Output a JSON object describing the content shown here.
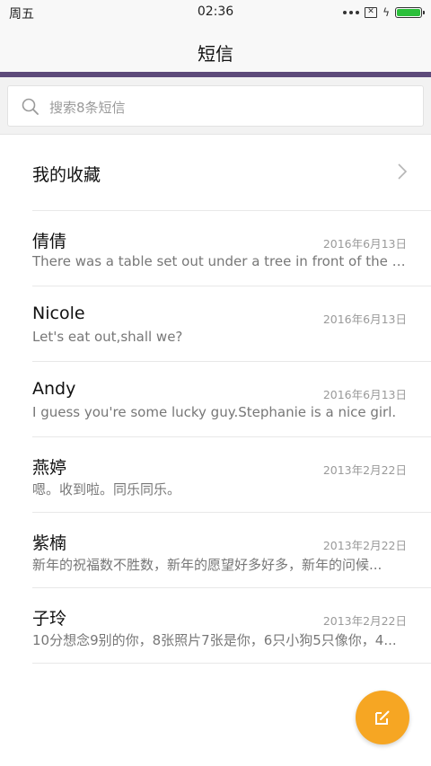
{
  "status": {
    "day": "周五",
    "time": "02:36",
    "battery_level": 1.0,
    "battery_color": "#2bbf3a"
  },
  "header": {
    "title": "短信",
    "accent_color": "#5d4a7a"
  },
  "search": {
    "placeholder": "搜索8条短信"
  },
  "favorites": {
    "label": "我的收藏"
  },
  "messages": [
    {
      "name": "倩倩",
      "date": "2016年6月13日",
      "preview": "There was a table set out under a tree in front of the ho..."
    },
    {
      "name": "Nicole",
      "date": "2016年6月13日",
      "preview": "Let's eat out,shall we?"
    },
    {
      "name": "Andy",
      "date": "2016年6月13日",
      "preview": "I guess you're some lucky guy.Stephanie is a nice girl."
    },
    {
      "name": "燕婷",
      "date": "2013年2月22日",
      "preview": "嗯。收到啦。同乐同乐。"
    },
    {
      "name": "紫楠",
      "date": "2013年2月22日",
      "preview": "新年的祝福数不胜数，新年的愿望好多好多，新年的问候..."
    },
    {
      "name": "子玲",
      "date": "2013年2月22日",
      "preview": "10分想念9别的你，8张照片7张是你，6只小狗5只像你，4..."
    }
  ],
  "fab": {
    "icon": "compose-icon",
    "color": "#f6a623"
  }
}
